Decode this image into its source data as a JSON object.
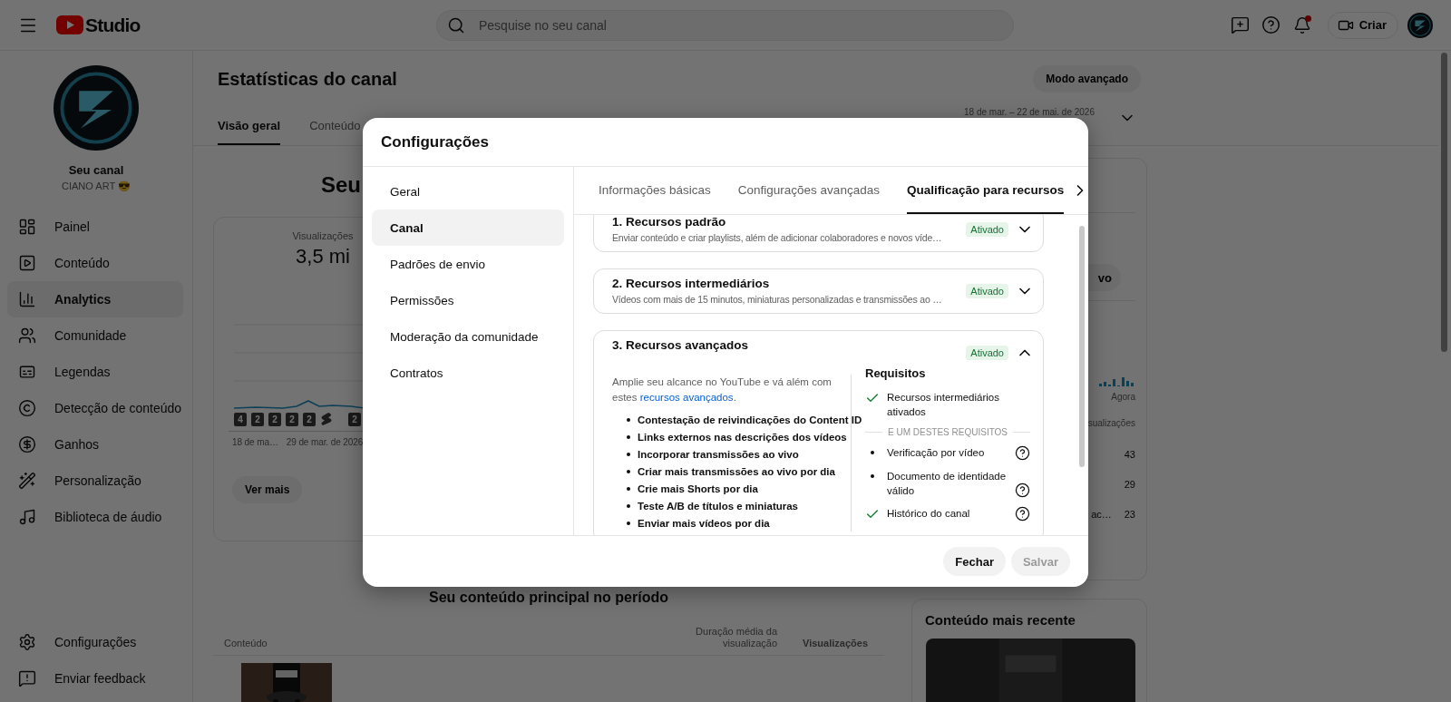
{
  "header": {
    "logo_text": "Studio",
    "search": {
      "placeholder": "Pesquise no seu canal"
    },
    "notification_dot": true,
    "create_button": "Criar"
  },
  "sidebar": {
    "channel_name": "Seu canal",
    "channel_handle": "CIANO ART 😎",
    "items": [
      {
        "label": "Painel",
        "selected": false
      },
      {
        "label": "Conteúdo",
        "selected": false
      },
      {
        "label": "Analytics",
        "selected": true
      },
      {
        "label": "Comunidade",
        "selected": false
      },
      {
        "label": "Legendas",
        "selected": false
      },
      {
        "label": "Detecção de conteúdo",
        "selected": false
      },
      {
        "label": "Ganhos",
        "selected": false
      },
      {
        "label": "Personalização",
        "selected": false
      },
      {
        "label": "Biblioteca de áudio",
        "selected": false
      }
    ],
    "footer_items": [
      {
        "label": "Configurações"
      },
      {
        "label": "Enviar feedback"
      }
    ]
  },
  "page": {
    "title": "Estatísticas do canal",
    "advanced_button": "Modo avançado",
    "date_range": "18 de mar. – 22 de mai. de 2026",
    "tabs": [
      {
        "label": "Visão geral",
        "selected": true
      },
      {
        "label": "Conteúdo",
        "selected": false
      }
    ]
  },
  "overview": {
    "heading": "Seu",
    "metric_label": "Visualizações",
    "metric_value": "3,5 mi",
    "markers": [
      {
        "kind": "count",
        "text": "4"
      },
      {
        "kind": "count",
        "text": "2"
      },
      {
        "kind": "count",
        "text": "2"
      },
      {
        "kind": "count",
        "text": "2"
      },
      {
        "kind": "count",
        "text": "2"
      },
      {
        "kind": "shorts"
      },
      {
        "kind": "count",
        "text": "2"
      }
    ],
    "x_labels": [
      "18 de ma…",
      "29 de mar. de 2026"
    ],
    "more_button": "Ver mais"
  },
  "top_content": {
    "heading": "Seu conteúdo principal no período",
    "columns": [
      "Conteúdo",
      "Duração média da visualização",
      "Visualizações"
    ]
  },
  "realtime": {
    "button_fragment": "vo",
    "axis_label": "Agora",
    "column_fragment": "sualizações",
    "rows": [
      {
        "views": "43"
      },
      {
        "views": "29"
      },
      {
        "title": "ac…",
        "views": "23"
      }
    ]
  },
  "latest": {
    "title": "Conteúdo mais recente"
  },
  "dialog": {
    "title": "Configurações",
    "nav": [
      {
        "label": "Geral",
        "selected": false
      },
      {
        "label": "Canal",
        "selected": true
      },
      {
        "label": "Padrões de envio",
        "selected": false
      },
      {
        "label": "Permissões",
        "selected": false
      },
      {
        "label": "Moderação da comunidade",
        "selected": false
      },
      {
        "label": "Contratos",
        "selected": false
      }
    ],
    "tabs": [
      {
        "label": "Informações básicas",
        "selected": false
      },
      {
        "label": "Configurações avançadas",
        "selected": false
      },
      {
        "label": "Qualificação para recursos",
        "selected": true
      }
    ],
    "cards": [
      {
        "title": "1. Recursos padrão",
        "description": "Enviar conteúdo e criar playlists, além de adicionar colaboradores e novos víde…",
        "status": "Ativado",
        "expanded": false
      },
      {
        "title": "2. Recursos intermediários",
        "description": "Vídeos com mais de 15 minutos, miniaturas personalizadas e transmissões ao …",
        "status": "Ativado",
        "expanded": false
      },
      {
        "title": "3. Recursos avançados",
        "status": "Ativado",
        "expanded": true,
        "intro": "Amplie seu alcance no YouTube e vá além com estes",
        "intro_link": "recursos avançados",
        "intro_end": ".",
        "features": [
          "Contestação de reivindicações do Content ID",
          "Links externos nas descrições dos vídeos",
          "Incorporar transmissões ao vivo",
          "Criar mais transmissões ao vivo por dia",
          "Crie mais Shorts por dia",
          "Teste A/B de títulos e miniaturas",
          "Enviar mais vídeos por dia"
        ],
        "requirements_title": "Requisitos",
        "requirements": [
          {
            "kind": "met",
            "text": "Recursos intermediários ativados",
            "help": false
          },
          {
            "kind": "divider",
            "text": "E UM DESTES REQUISITOS"
          },
          {
            "kind": "option",
            "text": "Verificação por vídeo",
            "help": true
          },
          {
            "kind": "option",
            "text": "Documento de identidade válido",
            "help": true
          },
          {
            "kind": "met",
            "text": "Histórico do canal",
            "help": true
          }
        ]
      }
    ],
    "buttons": [
      {
        "label": "Fechar",
        "disabled": false
      },
      {
        "label": "Salvar",
        "disabled": true
      }
    ]
  }
}
